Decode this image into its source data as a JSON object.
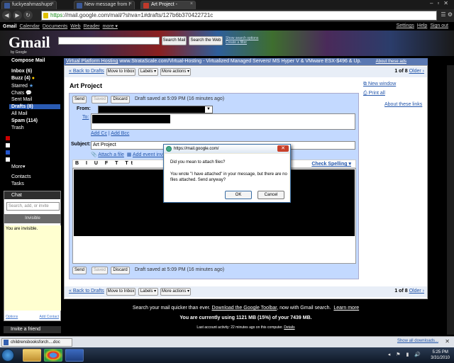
{
  "browser": {
    "tabs": [
      {
        "title": "fuckyeahmashups",
        "icon_color": "#3b5998"
      },
      {
        "title": "New message from I",
        "icon_color": "#3b5998"
      },
      {
        "title": "Art Project -",
        "icon_color": "#c0392b"
      }
    ],
    "url_scheme": "https",
    "url_rest": "://mail.google.com/mail/?shva=1#drafts/127b6b370422721c"
  },
  "topnav": {
    "left": [
      "Gmail",
      "Calendar",
      "Documents",
      "Web",
      "Reader",
      "more ▾"
    ],
    "right": [
      "Settings",
      "Help",
      "Sign out"
    ]
  },
  "header": {
    "logo": "Gmail",
    "logo_sub": "by Google",
    "search_mail": "Search Mail",
    "search_web": "Search the Web",
    "search_options": "Show search options",
    "create_filter": "Create a filter"
  },
  "leftnav": {
    "compose": "Compose Mail",
    "items": [
      {
        "label": "Inbox (6)",
        "bold": true
      },
      {
        "label": "Buzz (4)",
        "bold": true
      },
      {
        "label": "Starred",
        "bold": false
      },
      {
        "label": "Chats",
        "bold": false
      },
      {
        "label": "Sent Mail",
        "bold": false
      },
      {
        "label": "Drafts (8)",
        "bold": true
      },
      {
        "label": "All Mail",
        "bold": false
      },
      {
        "label": "Spam (114)",
        "bold": true
      },
      {
        "label": "Trash",
        "bold": false
      }
    ],
    "more": "More▾",
    "contacts": "Contacts",
    "tasks": "Tasks",
    "label_colors": [
      "#cc0000",
      "#ffffff",
      "#2255cc",
      "#ffffff"
    ]
  },
  "chat": {
    "header": "Chat",
    "search_placeholder": "Search, add, or invite",
    "status": "Invisible",
    "note": "You are invisible.",
    "options": "Options",
    "add_contact": "Add Contact",
    "invite": "Invite a friend"
  },
  "sponsor": {
    "text": "Virtual Platform Hosting",
    "url": "www.StrataScale.com/Virtual-Hosting",
    "desc": "- Virtualized Managed Servers! MS Hyper V & VMware ESX-$496 & Up.",
    "about": "About these ads"
  },
  "actions": {
    "back": "« Back to Drafts",
    "move_inbox": "Move to Inbox",
    "labels": "Labels ▾",
    "more_actions": "More actions ▾",
    "pager_count": "1 of 8",
    "older": "Older ›"
  },
  "message": {
    "title": "Art Project",
    "send": "Send",
    "saved": "Saved",
    "discard": "Discard",
    "draft_status": "Draft saved at 5:09 PM (16 minutes ago)",
    "from_label": "From:",
    "to_label": "To:",
    "add_cc": "Add Cc",
    "add_bcc": "Add Bcc",
    "subject_label": "Subject:",
    "subject_value": "Art Project",
    "attach_file": "Attach a file",
    "add_event": "Add event invit",
    "check_spelling": "Check Spelling ▾",
    "fmt_icons": "B I U F T Tt"
  },
  "rightlinks": {
    "new_window": "New window",
    "print_all": "Print all",
    "about_links": "About these links"
  },
  "dialog": {
    "title": "https://mail.google.com/",
    "question": "Did you mean to attach files?",
    "message": "You wrote \"I have attached\" in your message, but there are no files attached.  Send anyway?",
    "ok": "OK",
    "cancel": "Cancel"
  },
  "footer": {
    "line1_a": "Search your mail quicker than ever.",
    "line1_link": "Download the Google Toolbar",
    "line1_b": ", now with Gmail search.",
    "learn_more": "Learn more",
    "usage": "You are currently using 1121 MB (15%) of your 7439 MB.",
    "last_activity": "Last account activity: 22 minutes ago on this computer.",
    "details": "Details"
  },
  "downloads": {
    "file": "childrensbooksforch....doc",
    "show_all": "Show all downloads..."
  },
  "taskbar": {
    "time": "5:25 PM",
    "date": "3/31/2010"
  }
}
